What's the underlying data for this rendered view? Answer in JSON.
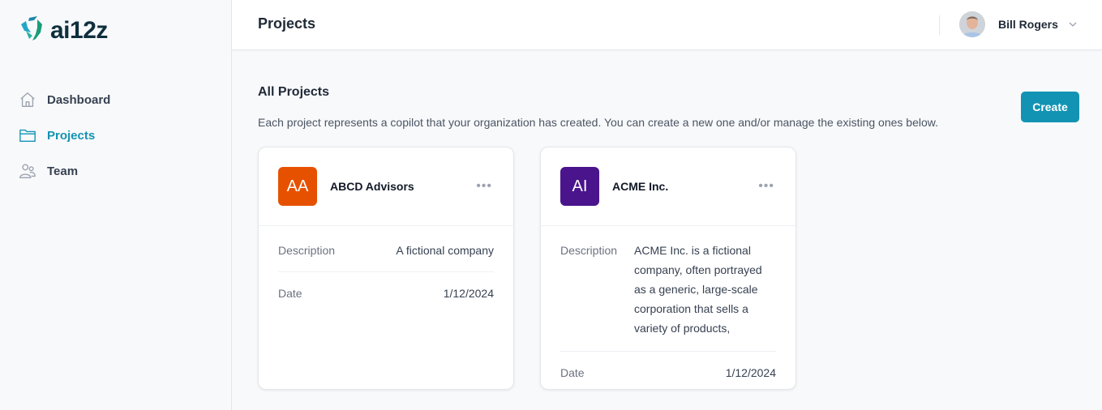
{
  "brand": {
    "name": "ai12z",
    "accent_color": "#1393b3"
  },
  "sidebar": {
    "items": [
      {
        "label": "Dashboard",
        "icon": "home-icon",
        "active": false
      },
      {
        "label": "Projects",
        "icon": "folder-icon",
        "active": true
      },
      {
        "label": "Team",
        "icon": "users-icon",
        "active": false
      }
    ]
  },
  "header": {
    "title": "Projects",
    "user": {
      "name": "Bill Rogers",
      "icon": "chevron-down-icon"
    }
  },
  "main": {
    "section_title": "All Projects",
    "section_description": "Each project represents a copilot that your organization has created. You can create a new one and/or manage the existing ones below.",
    "create_label": "Create",
    "projects": [
      {
        "initials": "AA",
        "name": "ABCD Advisors",
        "badge_color": "#e65100",
        "menu_icon": "ellipsis-icon",
        "description_label": "Description",
        "description": "A fictional company",
        "date_label": "Date",
        "date": "1/12/2024"
      },
      {
        "initials": "AI",
        "name": "ACME Inc.",
        "badge_color": "#4a148c",
        "menu_icon": "ellipsis-icon",
        "description_label": "Description",
        "description": "ACME Inc. is a fictional company, often portrayed as a generic, large-scale corporation that sells a variety of products,",
        "date_label": "Date",
        "date": "1/12/2024"
      }
    ]
  }
}
